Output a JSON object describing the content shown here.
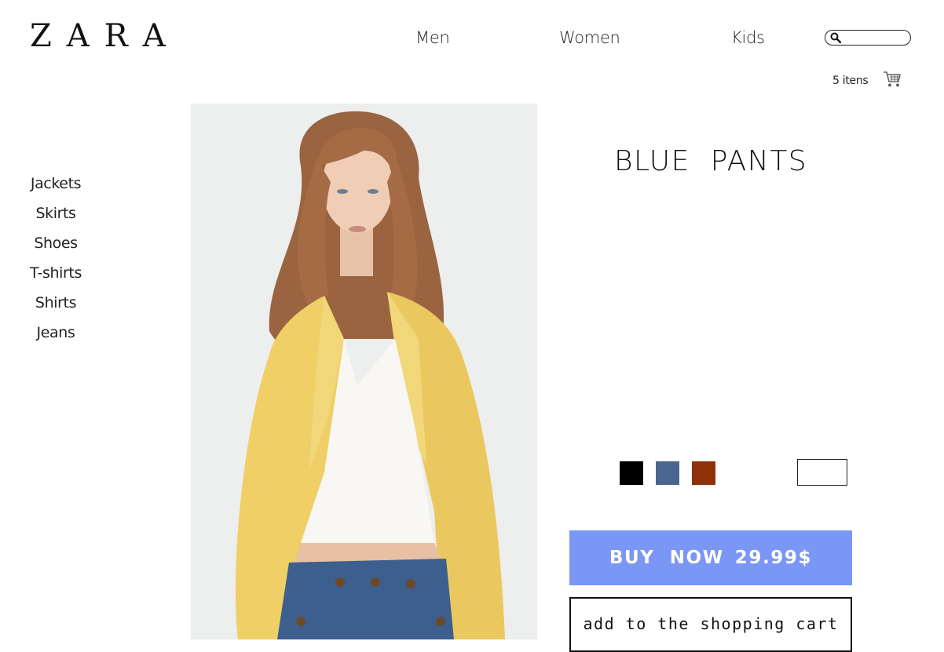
{
  "brand": {
    "logo": "ZARA"
  },
  "nav": [
    {
      "label": "Men"
    },
    {
      "label": "Women"
    },
    {
      "label": "Kids"
    }
  ],
  "search": {
    "placeholder": ""
  },
  "cart": {
    "count_label": "5 itens",
    "icon": "shopping-cart-icon"
  },
  "categories": [
    "Jackets",
    "Skirts",
    "Shoes",
    "T-shirts",
    "Shirts",
    "Jeans"
  ],
  "product": {
    "title": "BLUE  PANTS",
    "image": "model-yellow-jacket-photo",
    "colors": [
      "#000000",
      "#4a6690",
      "#8e3109"
    ],
    "size_value": ""
  },
  "actions": {
    "buy_label": "BUY  NOW",
    "price": "29.99$",
    "cart_label": "add to the shopping cart"
  }
}
